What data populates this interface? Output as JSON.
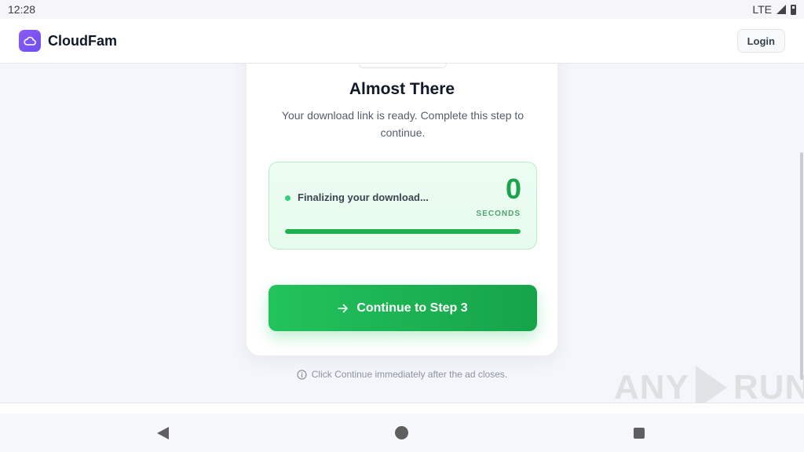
{
  "status_bar": {
    "time": "12:28",
    "network": "LTE"
  },
  "header": {
    "brand": "CloudFam",
    "login_label": "Login"
  },
  "card": {
    "title": "Almost There",
    "subtitle": "Your download link is ready. Complete this step to continue.",
    "progress": {
      "label": "Finalizing your download...",
      "count": "0",
      "unit": "SECONDS",
      "fill_fraction": 1.0
    },
    "continue_label": "Continue to Step 3"
  },
  "hint": "Click Continue immediately after the ad closes.",
  "watermark": {
    "left": "ANY",
    "right": "RUN"
  },
  "colors": {
    "accent": "#22c55e",
    "brand": "#7c5cf5",
    "counter": "#1aa34a"
  }
}
